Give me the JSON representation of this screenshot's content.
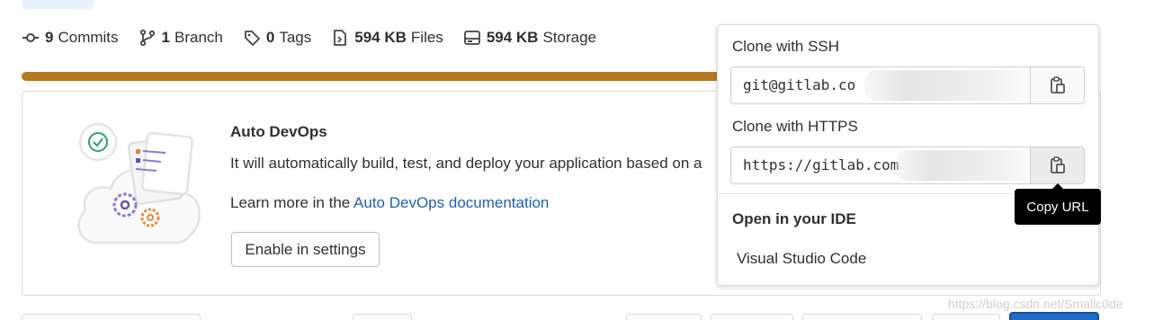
{
  "stats": {
    "commits": {
      "count": "9",
      "label": "Commits",
      "icon": "commit-icon"
    },
    "branches": {
      "count": "1",
      "label": "Branch",
      "icon": "branch-icon"
    },
    "tags": {
      "count": "0",
      "label": "Tags",
      "icon": "tag-icon"
    },
    "files": {
      "count": "594 KB",
      "label": "Files",
      "icon": "file-icon"
    },
    "storage": {
      "count": "594 KB",
      "label": "Storage",
      "icon": "storage-icon"
    }
  },
  "colors": {
    "progress": "#b57a1f",
    "progress_end": "#e2453c",
    "link": "#1f5fb8",
    "primary_button": "#1f6bc4",
    "tooltip_bg": "#000000"
  },
  "devops": {
    "title": "Auto DevOps",
    "description": "It will automatically build, test, and deploy your application based on a",
    "learn_prefix": "Learn more in the ",
    "learn_link": "Auto DevOps documentation",
    "enable_button": "Enable in settings"
  },
  "clone": {
    "ssh_label": "Clone with SSH",
    "ssh_url": "git@gitlab.co",
    "https_label": "Clone with HTTPS",
    "https_url": "https://gitlab.com",
    "copy_icon": "clipboard-icon",
    "ide_label": "Open in your IDE",
    "ide_item": "Visual Studio Code"
  },
  "tooltip": {
    "text": "Copy URL"
  },
  "watermark": "https://blog.csdn.net/Smallc0de"
}
